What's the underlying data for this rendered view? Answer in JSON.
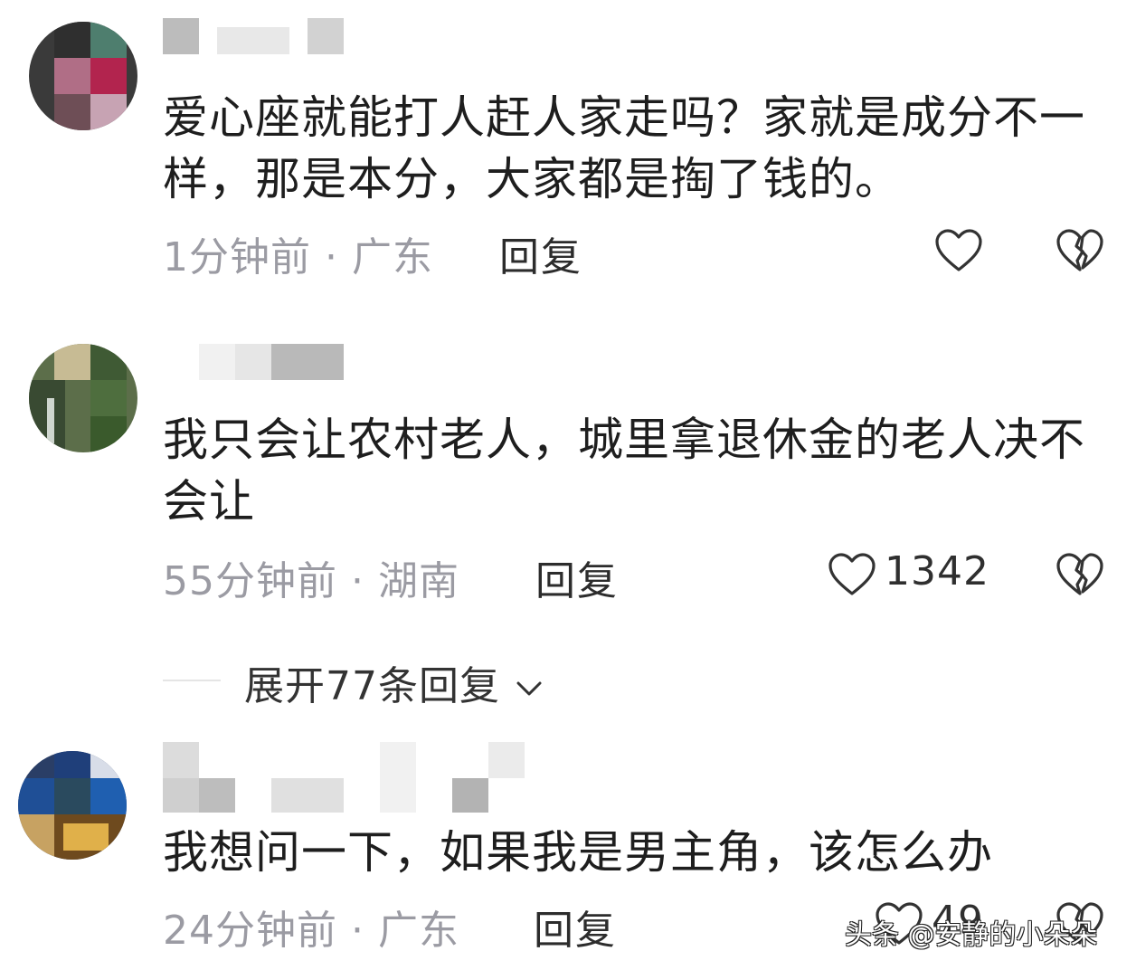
{
  "comments": [
    {
      "text": "爱心座就能打人赶人家走吗？家就是成分不一样，那是本分，大家都是掏了钱的。",
      "time": "1分钟前",
      "dot": "·",
      "location": "广东",
      "reply_label": "回复",
      "like_icon": "heart-outline-icon",
      "dislike_icon": "broken-heart-icon"
    },
    {
      "text": "我只会让农村老人，城里拿退休金的老人决不会让",
      "time": "55分钟前",
      "dot": "·",
      "location": "湖南",
      "reply_label": "回复",
      "likes": "1342",
      "like_icon": "heart-outline-icon",
      "dislike_icon": "broken-heart-icon"
    },
    {
      "text": "我想问一下，如果我是男主角，该怎么办",
      "time": "24分钟前",
      "dot": "·",
      "location": "广东",
      "reply_label": "回复",
      "likes": "49",
      "like_icon": "heart-outline-icon",
      "dislike_icon": "broken-heart-icon"
    }
  ],
  "expand_replies": {
    "label": "展开77条回复",
    "icon": "chevron-down-icon"
  },
  "watermark": "头条 @安静的小朵朵",
  "colors": {
    "meta": "#9b9ba3",
    "text": "#1e1e1e",
    "divider": "#e5e5e5"
  }
}
